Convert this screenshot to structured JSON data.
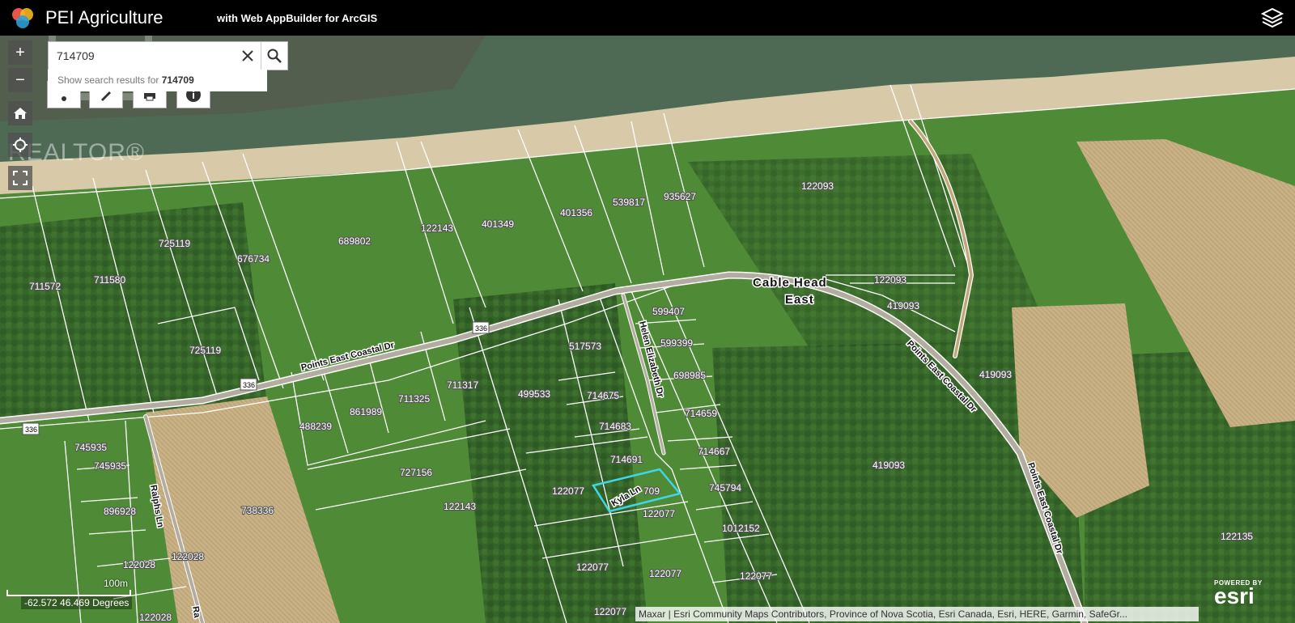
{
  "header": {
    "title": "PEI Agriculture",
    "subtitle": "with Web AppBuilder for ArcGIS",
    "layers_icon": "layers-icon"
  },
  "search": {
    "value": "714709",
    "placeholder": "",
    "suggestion_prefix": "Show search results for ",
    "suggestion_term": "714709"
  },
  "tools": {
    "zoom_in": "+",
    "zoom_out": "−"
  },
  "watermark": "REALTOR®",
  "map": {
    "parcels": [
      "122093",
      "122143",
      "401349",
      "401356",
      "539817",
      "935627",
      "725119",
      "676734",
      "689802",
      "711572",
      "711580",
      "122093",
      "419093",
      "599407",
      "517573",
      "599399",
      "725119",
      "698985",
      "711317",
      "499533",
      "714675",
      "419093",
      "711325",
      "861989",
      "714659",
      "714683",
      "488239",
      "745935",
      "745935",
      "714691",
      "714667",
      "727156",
      "122077",
      "709",
      "745794",
      "419093",
      "896928",
      "738336",
      "122143",
      "122077",
      "1012152",
      "122135",
      "122028",
      "122028",
      "122077",
      "122077",
      "122077",
      "122028",
      "122077"
    ],
    "roads": {
      "cable_head": "Cable Head",
      "east": "East",
      "points_east_w": "Points East Coastal Dr",
      "points_east_e": "Points East Coastal Dr",
      "points_east_s": "Points East Coastal Dr",
      "helen": "Helen Elizabeth Dr",
      "kyla": "Kyla Ln",
      "ralphs": "Ralphs Ln",
      "ralphs_b": "Ra",
      "route_1": "336",
      "route_2": "336",
      "route_3": "336"
    }
  },
  "status": {
    "coordinates": "-62.572 46.469 Degrees",
    "scale": "100m",
    "attribution": "Maxar | Esri Community Maps Contributors, Province of Nova Scotia, Esri Canada, Esri, HERE, Garmin, SafeGr...",
    "powered_by": "POWERED BY",
    "esri": "esri"
  },
  "colors": {
    "highlight": "#3ed6e8",
    "water": "#4e6a55",
    "beach": "#d8c9a8",
    "field": "#cbb387"
  }
}
